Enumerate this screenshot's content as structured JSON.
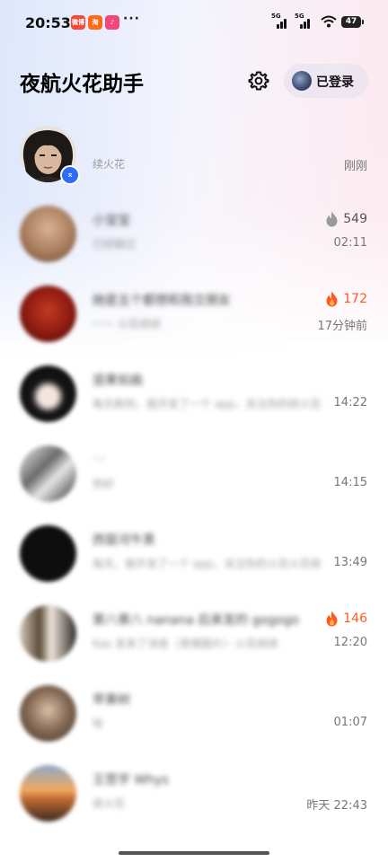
{
  "status_bar": {
    "time": "20:53",
    "app_icons": [
      {
        "name": "weibo-app-icon",
        "label": "微博",
        "color": "#f44a3a"
      },
      {
        "name": "taobao-app-icon",
        "label": "淘",
        "color": "#ff6a1a"
      },
      {
        "name": "music-app-icon",
        "label": "♪",
        "color": "#f2477a"
      }
    ],
    "more": "···",
    "signal_1": "5G",
    "signal_2": "5G",
    "battery": "47"
  },
  "header": {
    "title": "夜航火花助手",
    "login_label": "已登录"
  },
  "list": [
    {
      "name": "",
      "preview": "续火花",
      "time": "刚刚",
      "badge_count": "",
      "flame": "none",
      "avatar_color": "#3b3330",
      "blurred": false
    },
    {
      "name": "小宝宝",
      "preview": "已经聊过",
      "time": "02:11",
      "badge_count": "549",
      "flame": "gray",
      "avatar_color": "#a87c5c",
      "blurred": true
    },
    {
      "name": "她是五个都想和我交朋友",
      "preview": "一一 火花续续",
      "time": "17分钟前",
      "badge_count": "172",
      "flame": "orange",
      "avatar_color": "#9c1c10",
      "blurred": true
    },
    {
      "name": "竖果如画",
      "preview": "每天刷到，我开发了一个 app，关注你的续火花",
      "time": "14:22",
      "badge_count": "",
      "flame": "none",
      "avatar_color": "#1a1a1a",
      "blurred": true
    },
    {
      "name": "-.-",
      "preview": "你好",
      "time": "14:15",
      "badge_count": "",
      "flame": "none",
      "avatar_color": "#d9d9d9",
      "blurred": true
    },
    {
      "name": "西窗河牛蒸",
      "preview": "每天，我开发了一个 app，关注你的火花火花续",
      "time": "13:49",
      "badge_count": "",
      "flame": "none",
      "avatar_color": "#111111",
      "blurred": true
    },
    {
      "name": "第八章八 nanana 后来发的 gogogo",
      "preview": "Kas 发来了消息（表情图片）· 火花续续",
      "time": "12:20",
      "badge_count": "146",
      "flame": "orange",
      "avatar_color": "#8a7a6a",
      "blurred": true
    },
    {
      "name": "苹果树",
      "preview": "哈",
      "time": "01:07",
      "badge_count": "",
      "flame": "none",
      "avatar_color": "#6c5d52",
      "blurred": true
    },
    {
      "name": "王思宇 Whys",
      "preview": "续火花",
      "time": "昨天 22:43",
      "badge_count": "",
      "flame": "none",
      "avatar_color": "#c9885a",
      "blurred": true
    }
  ],
  "colors": {
    "flame_orange": "#ff5a1f",
    "flame_gray": "#9a9a9a",
    "accent_blue": "#2f6df6"
  }
}
